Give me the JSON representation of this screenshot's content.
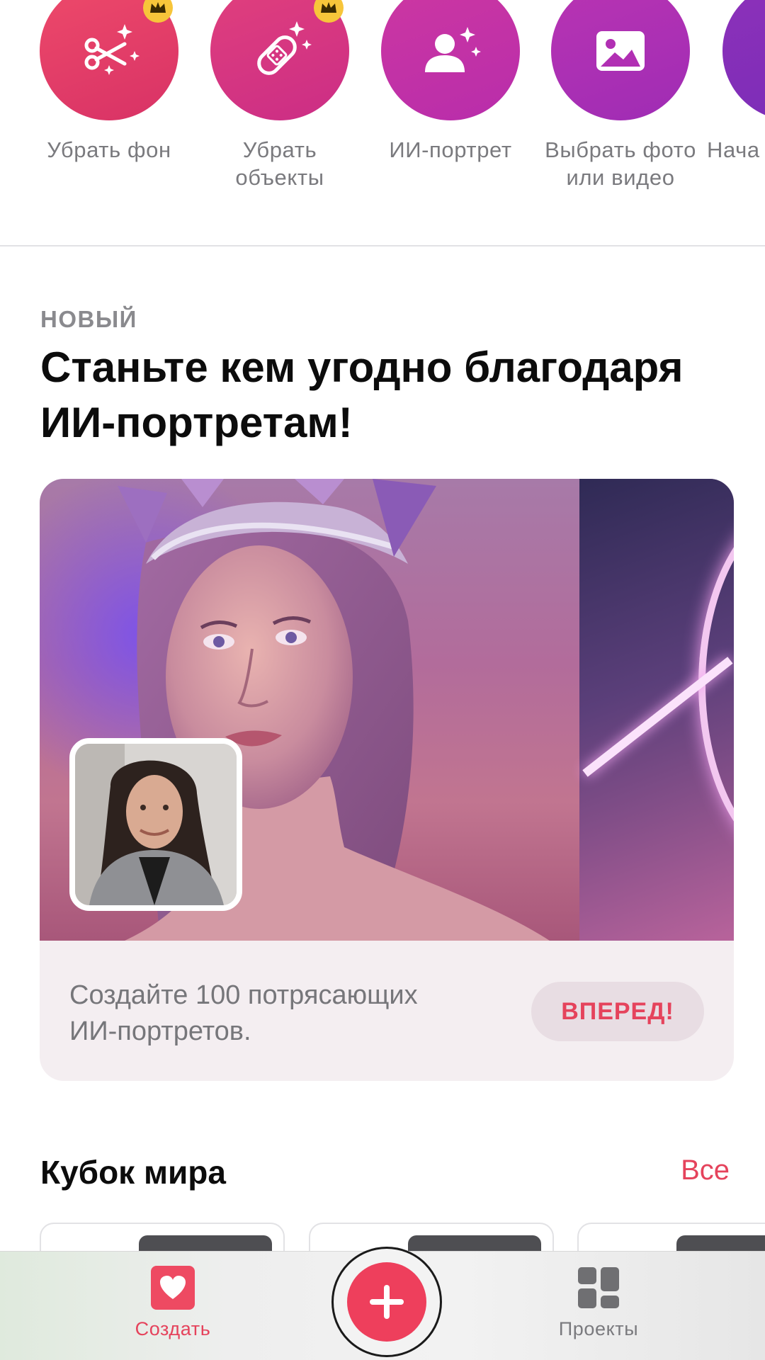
{
  "quick_actions": [
    {
      "label": "Убрать фон",
      "icon": "magic-scissors-icon",
      "premium": true,
      "color_from": "#ec4267",
      "color_to": "#d93367"
    },
    {
      "label": "Убрать объекты",
      "icon": "bandage-sparkle-icon",
      "premium": true,
      "color_from": "#dd3a7a",
      "color_to": "#cd2e86"
    },
    {
      "label": "ИИ-портрет",
      "icon": "person-sparkle-icon",
      "premium": false,
      "color_from": "#c933a0",
      "color_to": "#b92ea9"
    },
    {
      "label": "Выбрать фото или видео",
      "icon": "photo-icon",
      "premium": false,
      "color_from": "#b52eb0",
      "color_to": "#a02cb4"
    },
    {
      "label": "Нача",
      "icon": "",
      "premium": false,
      "color_from": "#8a2eb8",
      "color_to": "#7a2cb8"
    }
  ],
  "feature": {
    "eyebrow": "НОВЫЙ",
    "headline": "Станьте кем угодно благодаря ИИ-портретам!",
    "description": "Создайте 100 потрясающих ИИ-портретов.",
    "cta": "ВПЕРЕД!"
  },
  "world_cup": {
    "title": "Кубок мира",
    "see_all": "Все"
  },
  "tabbar": {
    "create_label": "Создать",
    "projects_label": "Проекты",
    "active_color": "#e5435c",
    "inactive_color": "#7a7a7e"
  }
}
